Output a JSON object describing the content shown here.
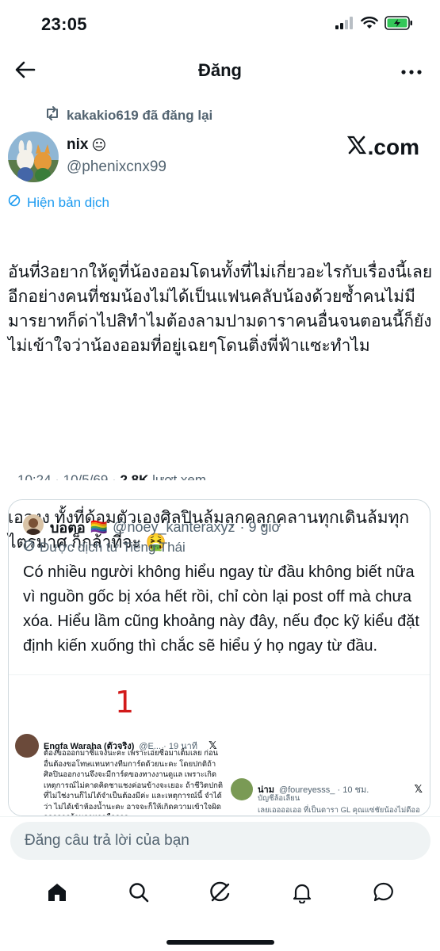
{
  "status_bar": {
    "time": "23:05",
    "icons": [
      "signal-icon",
      "wifi-icon",
      "battery-charging-icon"
    ]
  },
  "header": {
    "title": "Đăng",
    "back_icon": "arrow-left-icon",
    "more_icon": "more-horizontal-icon"
  },
  "repost": {
    "text": "kakakio619 đã đăng lại",
    "icon": "repost-icon"
  },
  "author": {
    "name": "nix",
    "emoji": "😐",
    "handle": "@phenixcnx99",
    "source_badge": ".com",
    "source_icon": "x-logo-icon"
  },
  "post": {
    "translate_label": "Hiện bản dịch",
    "paragraph_1": "อันที่3อยากให้ดูที่น้องออมโดนทั้งที่ไม่เกี่ยวอะไรกับเรื่องนี้เลยอีกอย่างคนที่ชมน้องไม่ได้เป็นแฟนคลับน้องด้วยซ้ำคนไม่มีมารยาทก็ด่าไปสิทำไมต้องลามปามดาราคนอื่นจนตอนนี้ก็ยังไม่เข้าใจว่าน้องออมที่อยู่เฉยๆโดนติ่งพี่ฟ้าแซะทำไม",
    "paragraph_2": "เอองง ทั้งที่ด้อมตัวเองศิลปินล้มลุกคลุกคลานทุกเดินล้มทุกไตรมาศ ก็กล้าที่จะ 🤮",
    "meta": "10:24 · 10/5/69 · ",
    "views_count": "2,8K",
    "views_label": "lượt xem"
  },
  "quote": {
    "name": "บอตอ",
    "flag": "🏳️‍🌈",
    "handle": "@noey_kanteraxyz",
    "time": "· 9 giờ",
    "translated_label": "Được dịch từ Tiếng Thái",
    "body": "Có nhiều người không hiểu ngay từ đầu không biết nữa vì nguồn gốc bị xóa hết rồi, chỉ còn lại post off mà chưa xóa. Hiểu lầm cũng khoảng này đây, nếu đọc kỹ kiểu đặt định kiến xuống thì chắc sẽ hiểu ý họ ngay từ đầu.",
    "image": {
      "number_label": "1",
      "embed_a": {
        "name": "Engfa Waraha (ตัวจริง)",
        "handle": "@E... · 19 นาที",
        "text": "ต้องขอออกมาชี้แจงนะคะ เพราะเอ่ยชื่อมาเต็มเลย ก่อนอื่นต้องขอโทษแทนทางทีมการ์ดด้วยนะคะ โดยปกติถ้าศิลปินออกงานจึงจะมีการ์ดของทางงานดูแล เพราะเกิดเหตุการณ์ไม่คาดคิดชาแชงค่อนข้างจะเยอะ ถ้าชีวิตปกติที่ไม่ใช่งานก็ไม่ได้จำเป็นต้องมีค่ะ และเหตุการณ์นี้ จำได้ว่า ไม่ได้เข้าห้องน้ำนะคะ อาจจะก็ให้เกิดความเข้าใจผิด ออกจากร้านอาหารคือการ"
      },
      "embed_b": {
        "name": "น่าม",
        "handle": "@foureyesss_ · 10 ชม.",
        "sub": "บัญชีล้อเลียน",
        "text": "เลยเออออเออ ที่เป็นดารา GL คุณแซ่ชัยน้องไม่ดีออ"
      }
    }
  },
  "reply": {
    "placeholder": "Đăng câu trả lời của bạn"
  },
  "bottom_nav": {
    "items": [
      "home-icon",
      "search-icon",
      "grok-icon",
      "notifications-icon",
      "messages-icon"
    ]
  }
}
